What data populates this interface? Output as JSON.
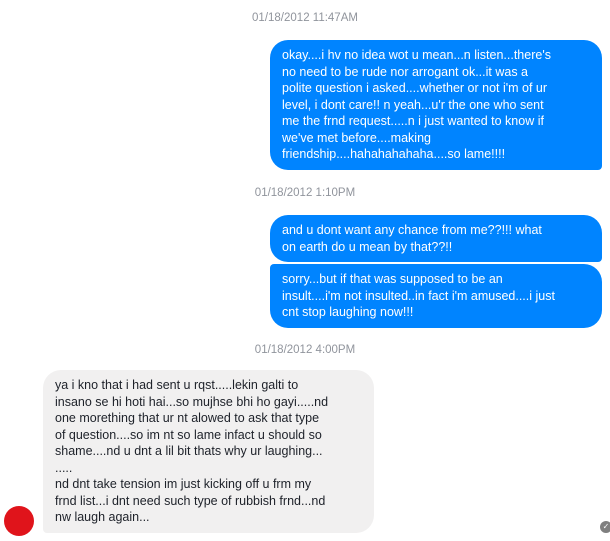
{
  "conversation": {
    "timestamps": [
      "01/18/2012 11:47AM",
      "01/18/2012 1:10PM",
      "01/18/2012 4:00PM"
    ],
    "messages": [
      {
        "direction": "outgoing",
        "text": "okay....i hv no idea wot u mean...n listen...there's\nno need to be rude nor arrogant ok...it was a\npolite question i asked....whether or not i'm of ur\nlevel, i dont care!! n yeah...u'r the one who sent\nme the frnd request.....n i just wanted to know if\nwe've met before....making\nfriendship....hahahahahaha....so lame!!!!"
      },
      {
        "direction": "outgoing",
        "text": "and u dont want any chance from me??!!! what\non earth do u mean by that??!!"
      },
      {
        "direction": "outgoing",
        "text": "sorry...but if that was supposed to be an\ninsult....i'm not insulted..in fact i'm amused....i just\ncnt stop laughing now!!!"
      },
      {
        "direction": "incoming",
        "text": "ya i kno that i had sent u rqst.....lekin galti to\ninsano se hi hoti hai...so mujhse bhi ho gayi.....nd\none morething that ur nt alowed to ask that type\nof question....so im nt so lame infact u should so\nshame....nd u dnt a lil bit thats why ur laughing...\n.....\nnd dnt take tension im just kicking off u frm my\nfrnd list...i dnt need such type of rubbish frnd...nd\nnw laugh again..."
      }
    ]
  },
  "colors": {
    "outgoing_bubble": "#0084ff",
    "incoming_bubble": "#f1f0f0",
    "avatar": "#e0141b"
  },
  "icons": {
    "avatar": "user-avatar",
    "seen": "seen-indicator-icon"
  }
}
